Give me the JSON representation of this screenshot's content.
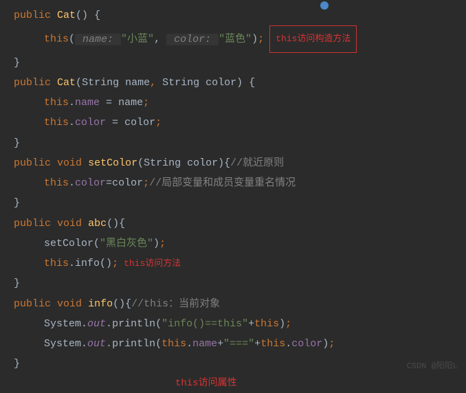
{
  "code": {
    "line1": {
      "kw1": "public",
      "type": "Cat",
      "paren": "()",
      "sp": " ",
      "brace": "{"
    },
    "line2": {
      "kw": "this",
      "p1": "(",
      "hint1": " name: ",
      "s1": "\"小蓝\"",
      "comma": ", ",
      "hint2": " color: ",
      "s2": "\"蓝色\"",
      "p2": ")",
      "semi": ";"
    },
    "line2_note_box": "this访问构造方法",
    "line3": {
      "brace": "}"
    },
    "line4": {
      "kw1": "public",
      "type": "Cat",
      "p1": "(",
      "ptype1": "String ",
      "pname1": "name",
      "comma": ", ",
      "ptype2": "String ",
      "pname2": "color",
      "p2": ")",
      "sp": " ",
      "brace": "{"
    },
    "line5": {
      "kw": "this",
      "dot": ".",
      "field": "name",
      "eq": " = ",
      "var": "name",
      "semi": ";"
    },
    "line6": {
      "kw": "this",
      "dot": ".",
      "field": "color",
      "eq": " = ",
      "var": "color",
      "semi": ";"
    },
    "line7": {
      "brace": "}"
    },
    "line8": {
      "kw1": "public",
      "kw2": "void",
      "method": "setColor",
      "p1": "(",
      "ptype": "String ",
      "pname": "color",
      "p2": ")",
      "brace": "{",
      "comment": "//就近原则"
    },
    "line9": {
      "kw": "this",
      "dot": ".",
      "field": "color",
      "eq": "=",
      "var": "color",
      "semi": ";",
      "comment": "//局部变量和成员变量重名情况"
    },
    "line10": {
      "brace": "}"
    },
    "line11": {
      "kw1": "public",
      "kw2": "void",
      "method": "abc",
      "paren": "()",
      "brace": "{"
    },
    "line12": {
      "method": "setColor",
      "p1": "(",
      "s": "\"黑白灰色\"",
      "p2": ")",
      "semi": ";"
    },
    "line13": {
      "kw": "this",
      "dot": ".",
      "method": "info",
      "paren": "()",
      "semi": ";"
    },
    "line13_note": "this访问方法",
    "line14": {
      "brace": "}"
    },
    "line15": {
      "kw1": "public",
      "kw2": "void",
      "method": "info",
      "paren": "()",
      "brace": "{",
      "comment": "//this：当前对象"
    },
    "line16": {
      "cls": "System",
      "dot1": ".",
      "out": "out",
      "dot2": ".",
      "method": "println",
      "p1": "(",
      "s1": "\"info()==this\"",
      "plus": "+",
      "kw": "this",
      "p2": ")",
      "semi": ";"
    },
    "line17": {
      "cls": "System",
      "dot1": ".",
      "out": "out",
      "dot2": ".",
      "method": "println",
      "p1": "(",
      "kw1": "this",
      "d1": ".",
      "f1": "name",
      "plus1": "+",
      "s": "\"===\"",
      "plus2": "+",
      "kw2": "this",
      "d2": ".",
      "f2": "color",
      "p2": ")",
      "semi": ";"
    },
    "line18": {
      "brace": "}"
    },
    "note_standalone": "this访问属性"
  },
  "watermark": "CSDN @阳阳L"
}
